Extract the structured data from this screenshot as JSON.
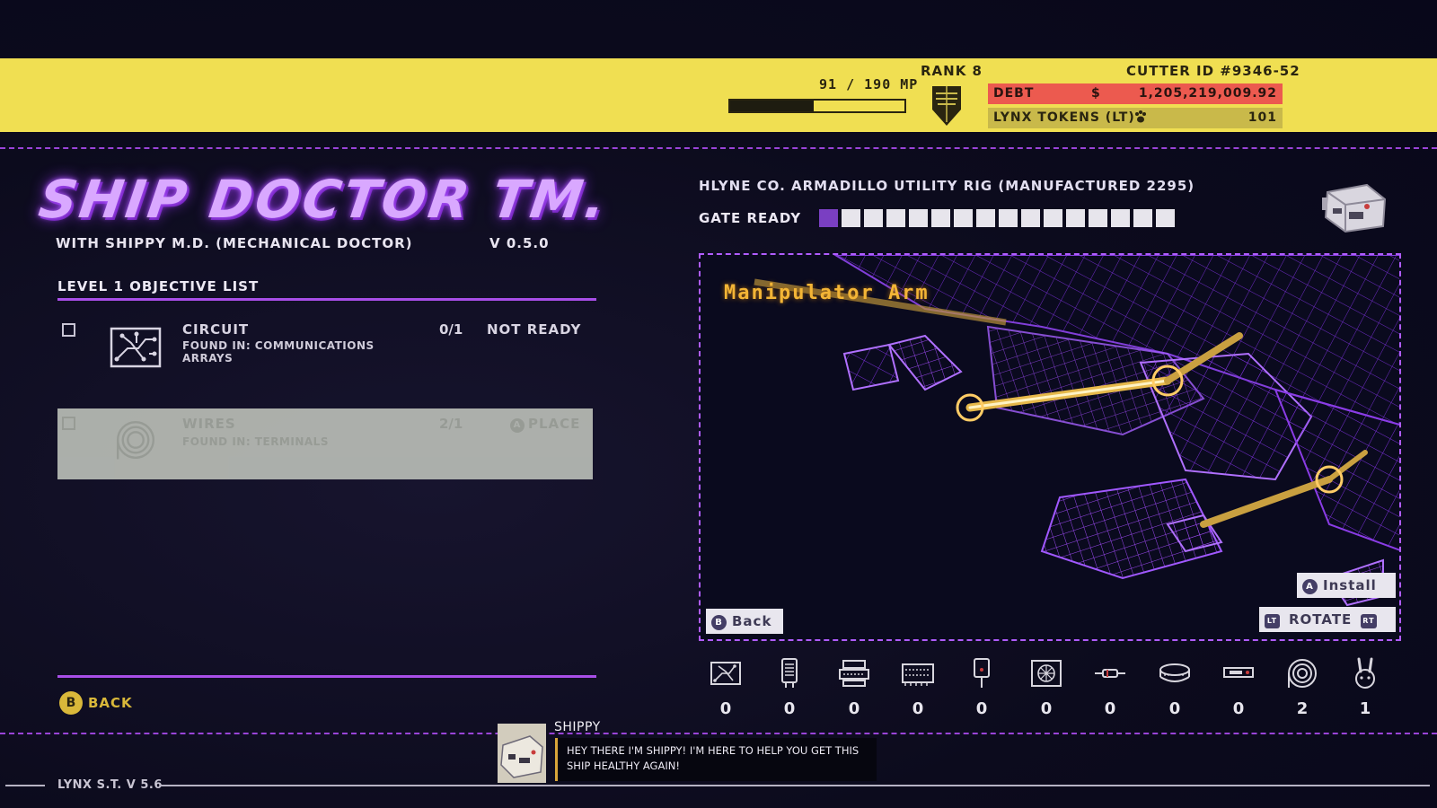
{
  "header": {
    "mp_text": "91 / 190 MP",
    "mp_progress": 0.479,
    "rank_text": "RANK 8",
    "cutter_id": "CUTTER ID  #9346-52",
    "debt_label": "DEBT",
    "debt_currency": "$",
    "debt_value": "1,205,219,009.92",
    "lt_label": "LYNX TOKENS (LT)",
    "lt_icon": "paw-icon",
    "lt_value": "101"
  },
  "app": {
    "title": "SHIP DOCTOR TM.",
    "subtitle": "WITH SHIPPY M.D. (MECHANICAL DOCTOR)",
    "version": "V 0.5.0"
  },
  "objectives": {
    "title": "LEVEL 1 OBJECTIVE LIST",
    "items": [
      {
        "name": "CIRCUIT",
        "found_in": "FOUND IN: COMMUNICATIONS ARRAYS",
        "count": "0/1",
        "status": "NOT READY",
        "icon": "circuit-board-icon"
      },
      {
        "name": "WIRES",
        "found_in": "FOUND IN: TERMINALS",
        "count": "2/1",
        "status_button": "A",
        "status": "PLACE",
        "icon": "wire-coil-icon"
      }
    ]
  },
  "back_left": {
    "button": "B",
    "label": "BACK"
  },
  "ship": {
    "name": "HLYNE CO. ARMADILLO UTILITY RIG (MANUFACTURED 2295)",
    "gate_label": "GATE READY",
    "gate_total": 16,
    "gate_filled": 1
  },
  "viewport": {
    "part_name": "Manipulator Arm",
    "install_button": "A",
    "install_label": "Install",
    "rotate_left": "LT",
    "rotate_label": "ROTATE",
    "rotate_right": "RT",
    "back_button": "B",
    "back_label": "Back"
  },
  "inventory": [
    {
      "icon": "circuit-board-icon",
      "count": "0"
    },
    {
      "icon": "terminal-icon",
      "count": "0"
    },
    {
      "icon": "capacitor-icon",
      "count": "0"
    },
    {
      "icon": "ram-chip-icon",
      "count": "0"
    },
    {
      "icon": "fuse-icon",
      "count": "0"
    },
    {
      "icon": "fan-icon",
      "count": "0"
    },
    {
      "icon": "resistor-icon",
      "count": "0"
    },
    {
      "icon": "battery-cell-icon",
      "count": "0"
    },
    {
      "icon": "connector-icon",
      "count": "0"
    },
    {
      "icon": "wire-coil-icon",
      "count": "2"
    },
    {
      "icon": "lynx-rabbit-icon",
      "count": "1"
    }
  ],
  "dialogue": {
    "speaker": "SHIPPY",
    "text": "HEY THERE I'M SHIPPY! I'M HERE TO HELP YOU GET THIS SHIP HEALTHY AGAIN!"
  },
  "footer": {
    "version": "LYNX S.T. V 5.6"
  },
  "colors": {
    "accent_yellow": "#f0df52",
    "accent_purple": "#a84ee8",
    "debt_red": "#ec5a4f",
    "part_orange": "#f3b536"
  }
}
